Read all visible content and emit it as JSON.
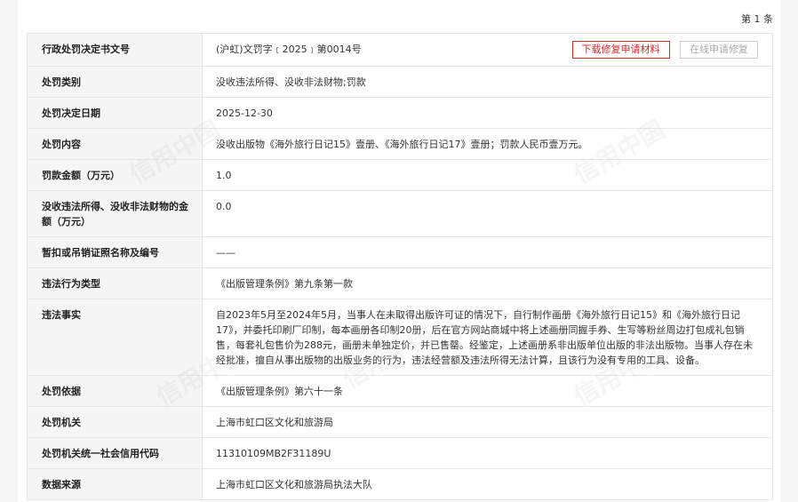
{
  "page_count": "第 1 条",
  "buttons": {
    "download": "下载修复申请材料",
    "online_repair": "在线申请修复"
  },
  "rows": [
    {
      "label": "行政处罚决定书文号",
      "value": "(沪虹)文罚字﹝2025﹞第0014号"
    },
    {
      "label": "处罚类别",
      "value": "没收违法所得、没收非法财物;罚款"
    },
    {
      "label": "处罚决定日期",
      "value": "2025-12-30"
    },
    {
      "label": "处罚内容",
      "value": "没收出版物《海外旅行日记15》壹册、《海外旅行日记17》壹册；罚款人民币壹万元。"
    },
    {
      "label": "罚款金额（万元）",
      "value": "1.0"
    },
    {
      "label": "没收违法所得、没收非法财物的金额（万元）",
      "value": "0.0"
    },
    {
      "label": "暂扣或吊销证照名称及编号",
      "value": "——"
    },
    {
      "label": "违法行为类型",
      "value": "《出版管理条例》第九条第一款"
    },
    {
      "label": "违法事实",
      "value": "自2023年5月至2024年5月，当事人在未取得出版许可证的情况下，自行制作画册《海外旅行日记15》和《海外旅行日记17》，并委托印刷厂印制，每本画册各印制20册，后在官方网站商城中将上述画册同握手券、生写等粉丝周边打包成礼包销售，每套礼包售价为288元，画册未单独定价，并已售罄。经鉴定，上述画册系非出版单位出版的非法出版物。当事人存在未经批准，擅自从事出版物的出版业务的行为，违法经营额及违法所得无法计算，且该行为没有专用的工具、设备。"
    },
    {
      "label": "处罚依据",
      "value": "《出版管理条例》第六十一条"
    },
    {
      "label": "处罚机关",
      "value": "上海市虹口区文化和旅游局"
    },
    {
      "label": "处罚机关统一社会信用代码",
      "value": "11310109MB2F31189U"
    },
    {
      "label": "数据来源",
      "value": "上海市虹口区文化和旅游局执法大队"
    }
  ],
  "watermark_text": "信用中国"
}
